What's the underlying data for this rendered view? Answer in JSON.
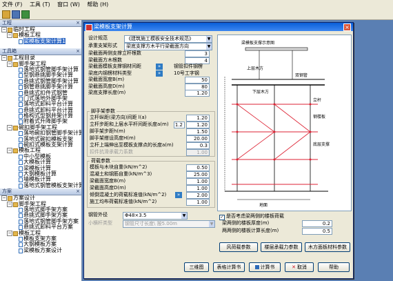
{
  "menu": [
    "文件 (F)",
    "工具 (T)",
    "窗口 (W)",
    "帮助 (H)"
  ],
  "left": {
    "panel1_title": "工程",
    "panel2_title": "工具箱",
    "panel3_title": "方案",
    "tree1": [
      {
        "label": "临时工程",
        "lvl": 0,
        "type": "folder",
        "exp": "−"
      },
      {
        "label": "模板工程",
        "lvl": 1,
        "type": "folder",
        "exp": "−"
      },
      {
        "label": "梁模板支架计算1",
        "lvl": 2,
        "type": "doc",
        "sel": true
      }
    ],
    "tree2": [
      {
        "label": "工程目录",
        "lvl": 0,
        "type": "folder",
        "exp": "−"
      },
      {
        "label": "脚手架工程",
        "lvl": 1,
        "type": "folder",
        "exp": "−"
      },
      {
        "label": "落地式钢管脚手架计算",
        "lvl": 2,
        "type": "doc"
      },
      {
        "label": "型钢悬挑脚手架计算",
        "lvl": 2,
        "type": "doc"
      },
      {
        "label": "悬挑式钢管脚手架计算",
        "lvl": 2,
        "type": "doc"
      },
      {
        "label": "钢管悬挑脚手架计算",
        "lvl": 2,
        "type": "doc"
      },
      {
        "label": "悬挑式扣件式钢管",
        "lvl": 2,
        "type": "doc"
      },
      {
        "label": "门式落地外脚手架",
        "lvl": 2,
        "type": "doc"
      },
      {
        "label": "落地式卸料平台计算",
        "lvl": 2,
        "type": "doc"
      },
      {
        "label": "悬挑式卸料平台计算",
        "lvl": 2,
        "type": "doc"
      },
      {
        "label": "格构式型钢井架计算",
        "lvl": 2,
        "type": "doc"
      },
      {
        "label": "附着式升降脚手架",
        "lvl": 2,
        "type": "doc"
      },
      {
        "label": "碗扣脚手架工程",
        "lvl": 1,
        "type": "folder",
        "exp": "−"
      },
      {
        "label": "落地碗扣钢管脚手架计算",
        "lvl": 2,
        "type": "doc"
      },
      {
        "label": "落地式碗扣模板支架",
        "lvl": 2,
        "type": "doc"
      },
      {
        "label": "碗扣式模板支架计算",
        "lvl": 2,
        "type": "doc"
      },
      {
        "label": "模板工程",
        "lvl": 1,
        "type": "folder",
        "exp": "−"
      },
      {
        "label": "中小型模板",
        "lvl": 2,
        "type": "doc"
      },
      {
        "label": "大模板计算",
        "lvl": 2,
        "type": "doc"
      },
      {
        "label": "梁模板计算",
        "lvl": 2,
        "type": "doc"
      },
      {
        "label": "大钢模板计算",
        "lvl": 2,
        "type": "doc"
      },
      {
        "label": "墙模板计算",
        "lvl": 2,
        "type": "doc"
      },
      {
        "label": "落地式钢管模板支架计算",
        "lvl": 2,
        "type": "doc"
      }
    ],
    "tree3": [
      {
        "label": "方案设计",
        "lvl": 0,
        "type": "folder",
        "exp": "−"
      },
      {
        "label": "脚手架工程",
        "lvl": 1,
        "type": "folder",
        "exp": "−"
      },
      {
        "label": "落地式脚手架方案",
        "lvl": 2,
        "type": "doc"
      },
      {
        "label": "悬挑式脚手架方案",
        "lvl": 2,
        "type": "doc"
      },
      {
        "label": "落地式钢管脚手架方案",
        "lvl": 2,
        "type": "doc"
      },
      {
        "label": "悬挑式卸料平台方案",
        "lvl": 2,
        "type": "doc"
      },
      {
        "label": "模板工程",
        "lvl": 1,
        "type": "folder",
        "exp": "−"
      },
      {
        "label": "模板支架方案",
        "lvl": 2,
        "type": "doc"
      },
      {
        "label": "大钢模板方案",
        "lvl": 2,
        "type": "doc"
      },
      {
        "label": "梁模板方案设计",
        "lvl": 2,
        "type": "doc"
      }
    ]
  },
  "dialog": {
    "title": "梁模板支架计算",
    "rows": [
      {
        "label": "设计规范",
        "kind": "select",
        "value": "《建筑施工模板安全技术规范》"
      },
      {
        "label": "承重支架形式",
        "kind": "select",
        "value": "梁底支撑方木平行梁截面方向"
      },
      {
        "label": "梁截面两侧支撑立杆根数",
        "kind": "input",
        "value": "3"
      },
      {
        "label": "梁截面方木根数",
        "kind": "input",
        "value": "4"
      },
      {
        "label": "梁截面模板支撑钢材间距",
        "kind": "text",
        "value": "钢管扣件钢楞",
        "arrow": true
      },
      {
        "label": "梁底内钢楞材料类型",
        "kind": "text",
        "value": "10号工字钢",
        "arrow": true
      },
      {
        "label": "梁截面宽度B(m)",
        "kind": "input",
        "value": "50"
      },
      {
        "label": "梁截面高度D(m)",
        "kind": "input",
        "value": "80"
      },
      {
        "label": "梁底支撑长度(m)",
        "kind": "input",
        "value": "1.20"
      }
    ],
    "group1_title": "脚手架参数",
    "group1": [
      {
        "label": "立杆纵距(梁方向)间距 l(a)",
        "value": "1.20"
      },
      {
        "label": "立杆步距和上层水平杆间距长度a(m)",
        "value": "1.20",
        "value2": "1.2"
      },
      {
        "label": "脚手架步距h(m)",
        "value": "1.50"
      },
      {
        "label": "脚手架搭设高度H(m)",
        "value": "20.00"
      },
      {
        "label": "立杆上端伸出至模板支撑点的长度a(m)",
        "value": "0.3"
      },
      {
        "label": "扣件抗滑承载力系数",
        "value": "1.00",
        "disabled": true
      }
    ],
    "group2_title": "荷载参数",
    "group2": [
      {
        "label": "模板与木块自重(kN/m^2)",
        "value": "0.50"
      },
      {
        "label": "混凝土和钢筋自重(kN/m^3)",
        "value": "25.00"
      },
      {
        "label": "梁截面宽度B(m)",
        "value": "1.00"
      },
      {
        "label": "梁截面高度D(m)",
        "value": "1.00"
      },
      {
        "label": "倾倒混凝土的荷载标准值(kN/m^2)",
        "value": "2.00",
        "arrow": true
      },
      {
        "label": "施工均布荷载标准值(kN/m^2)",
        "value": "1.00"
      }
    ],
    "steel_label": "钢管外径",
    "steel_value": "Φ48×3.5",
    "extra_label": "小横杆类型",
    "extra_value": "钢管尺寸长度\\ 按5.00m",
    "consider_label": "是否考虑梁两侧的楼板荷载",
    "slab_thickness_label": "梁两侧的楼板厚度(m)",
    "slab_thickness_value": "0.2",
    "slab_length_label": "两两侧的楼板计算长度(m)",
    "slab_length_value": "0.5",
    "mid_buttons": [
      "风荷载参数",
      "楼层承载力参数",
      "木方面板材料参数"
    ],
    "bottom_buttons": [
      "三维图",
      "表格计算书",
      "计算书",
      "取消",
      "帮助"
    ],
    "drawing_labels": [
      "梁模板支撑示意图",
      "上层木方",
      "双钢管",
      "下层木方",
      "立杆",
      "钢楼板",
      "底层支撑",
      "地面"
    ]
  }
}
